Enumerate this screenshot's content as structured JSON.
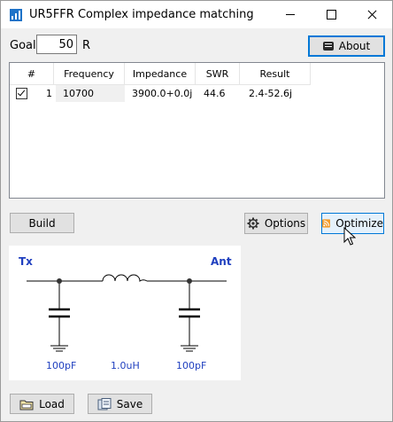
{
  "window": {
    "title": "UR5FFR Complex impedance matching"
  },
  "goal": {
    "label": "Goal",
    "value": "50",
    "unit": "R"
  },
  "buttons": {
    "about": "About",
    "build": "Build",
    "options": "Options",
    "optimize": "Optimize",
    "load": "Load",
    "save": "Save"
  },
  "table": {
    "headers": [
      "#",
      "Frequency",
      "Impedance",
      "SWR",
      "Result"
    ],
    "rows": [
      {
        "checked": true,
        "num": "1",
        "frequency": "10700",
        "impedance": "3900.0+0.0j",
        "swr": "44.6",
        "result": "2.4-52.6j"
      }
    ]
  },
  "schematic": {
    "source_label": "Tx",
    "load_label": "Ant",
    "c1": "100pF",
    "l1": "1.0uH",
    "c2": "100pF",
    "label_color": "#1f3fbf"
  },
  "icons": {
    "app": "app-icon",
    "about": "about-icon",
    "options": "gear-icon",
    "optimize": "rss-icon",
    "load": "load-icon",
    "save": "save-icon"
  }
}
